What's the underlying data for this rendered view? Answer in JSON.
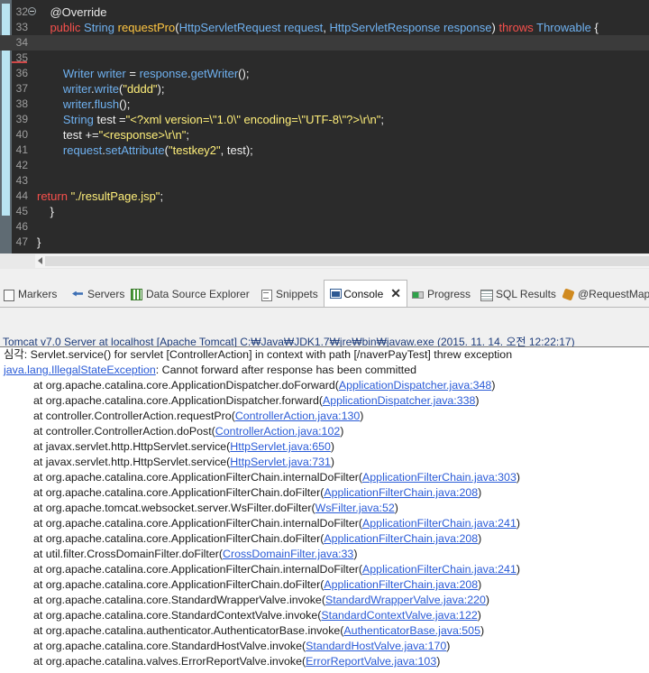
{
  "editor": {
    "lines": [
      {
        "n": "32",
        "tokens": [
          {
            "c": "ann",
            "t": "    @Override"
          }
        ],
        "fold": true
      },
      {
        "n": "33",
        "tokens": [
          {
            "c": "kw",
            "t": "    public"
          },
          {
            "c": "pl",
            "t": " "
          },
          {
            "c": "ty",
            "t": "String"
          },
          {
            "c": "pl",
            "t": " "
          },
          {
            "c": "fn",
            "t": "requestPro"
          },
          {
            "c": "pl",
            "t": "("
          },
          {
            "c": "ty",
            "t": "HttpServletRequest"
          },
          {
            "c": "pl",
            "t": " "
          },
          {
            "c": "ty",
            "t": "request"
          },
          {
            "c": "pl",
            "t": ", "
          },
          {
            "c": "ty",
            "t": "HttpServletResponse"
          },
          {
            "c": "pl",
            "t": " "
          },
          {
            "c": "ty",
            "t": "response"
          },
          {
            "c": "pl",
            "t": ") "
          },
          {
            "c": "kw",
            "t": "throws"
          },
          {
            "c": "pl",
            "t": " "
          },
          {
            "c": "ty",
            "t": "Throwable"
          },
          {
            "c": "pl",
            "t": " {"
          }
        ]
      },
      {
        "n": "34",
        "tokens": [],
        "current": true
      },
      {
        "n": "35",
        "tokens": []
      },
      {
        "n": "36",
        "tokens": [
          {
            "c": "ty",
            "t": "        Writer"
          },
          {
            "c": "pl",
            "t": " "
          },
          {
            "c": "ty",
            "t": "writer"
          },
          {
            "c": "pl",
            "t": " = "
          },
          {
            "c": "ty",
            "t": "response"
          },
          {
            "c": "pl",
            "t": "."
          },
          {
            "c": "ty",
            "t": "getWriter"
          },
          {
            "c": "pl",
            "t": "();"
          }
        ]
      },
      {
        "n": "37",
        "tokens": [
          {
            "c": "ty",
            "t": "        writer"
          },
          {
            "c": "pl",
            "t": "."
          },
          {
            "c": "ty",
            "t": "write"
          },
          {
            "c": "pl",
            "t": "("
          },
          {
            "c": "st",
            "t": "\"dddd\""
          },
          {
            "c": "pl",
            "t": ");"
          }
        ]
      },
      {
        "n": "38",
        "tokens": [
          {
            "c": "ty",
            "t": "        writer"
          },
          {
            "c": "pl",
            "t": "."
          },
          {
            "c": "ty",
            "t": "flush"
          },
          {
            "c": "pl",
            "t": "();"
          }
        ]
      },
      {
        "n": "39",
        "tokens": [
          {
            "c": "ty",
            "t": "        String"
          },
          {
            "c": "pl",
            "t": " test ="
          },
          {
            "c": "st",
            "t": "\"<?xml version=\\\"1.0\\\" encoding=\\\"UTF-8\\\"?>\\r\\n\""
          },
          {
            "c": "pl",
            "t": ";"
          }
        ]
      },
      {
        "n": "40",
        "tokens": [
          {
            "c": "pl",
            "t": "        test +="
          },
          {
            "c": "st",
            "t": "\"<response>\\r\\n\""
          },
          {
            "c": "pl",
            "t": ";"
          }
        ]
      },
      {
        "n": "41",
        "tokens": [
          {
            "c": "ty",
            "t": "        request"
          },
          {
            "c": "pl",
            "t": "."
          },
          {
            "c": "ty",
            "t": "setAttribute"
          },
          {
            "c": "pl",
            "t": "("
          },
          {
            "c": "st",
            "t": "\"testkey2\""
          },
          {
            "c": "pl",
            "t": ", test);"
          }
        ]
      },
      {
        "n": "42",
        "tokens": []
      },
      {
        "n": "43",
        "tokens": []
      },
      {
        "n": "44",
        "tokens": [
          {
            "c": "kw",
            "t": "return"
          },
          {
            "c": "pl",
            "t": " "
          },
          {
            "c": "st",
            "t": "\"./resultPage.jsp\""
          },
          {
            "c": "pl",
            "t": ";"
          }
        ]
      },
      {
        "n": "45",
        "tokens": [
          {
            "c": "pl",
            "t": "    }"
          }
        ]
      },
      {
        "n": "46",
        "tokens": []
      },
      {
        "n": "47",
        "tokens": [
          {
            "c": "pl",
            "t": "}"
          }
        ]
      }
    ]
  },
  "views": {
    "tabs": [
      {
        "label": "Markers",
        "icon": "markers-icon",
        "cls": "ico-markers"
      },
      {
        "label": "Servers",
        "icon": "servers-icon",
        "cls": "ico-servers"
      },
      {
        "label": "Data Source Explorer",
        "icon": "data-source-explorer-icon",
        "cls": "ico-ds"
      },
      {
        "label": "Snippets",
        "icon": "snippets-icon",
        "cls": "ico-snip"
      },
      {
        "label": "Console",
        "icon": "console-icon",
        "cls": "ico-console",
        "active": true,
        "close": "✕"
      },
      {
        "label": "Progress",
        "icon": "progress-icon",
        "cls": "ico-progress"
      },
      {
        "label": "SQL Results",
        "icon": "sql-results-icon",
        "cls": "ico-sql"
      },
      {
        "label": "@RequestMap",
        "icon": "request-mapping-icon",
        "cls": "ico-rm"
      }
    ],
    "console_title": "Tomcat v7.0 Server at localhost [Apache Tomcat] C:₩Java₩JDK1.7₩jre₩bin₩javaw.exe (2015. 11. 14. 오전 12:22:17)"
  },
  "console": {
    "lines": [
      {
        "text": "심각: Servlet.service() for servlet [ControllerAction] in context with path [/naverPayTest] threw exception",
        "indent": false
      },
      {
        "link": "java.lang.IllegalStateException",
        "text": ": Cannot forward after response has been committed",
        "indent": false,
        "leadLink": true
      },
      {
        "text": "at org.apache.catalina.core.ApplicationDispatcher.doForward(",
        "link": "ApplicationDispatcher.java:348",
        "tail": ")",
        "indent": true
      },
      {
        "text": "at org.apache.catalina.core.ApplicationDispatcher.forward(",
        "link": "ApplicationDispatcher.java:338",
        "tail": ")",
        "indent": true
      },
      {
        "text": "at controller.ControllerAction.requestPro(",
        "link": "ControllerAction.java:130",
        "tail": ")",
        "indent": true
      },
      {
        "text": "at controller.ControllerAction.doPost(",
        "link": "ControllerAction.java:102",
        "tail": ")",
        "indent": true
      },
      {
        "text": "at javax.servlet.http.HttpServlet.service(",
        "link": "HttpServlet.java:650",
        "tail": ")",
        "indent": true
      },
      {
        "text": "at javax.servlet.http.HttpServlet.service(",
        "link": "HttpServlet.java:731",
        "tail": ")",
        "indent": true
      },
      {
        "text": "at org.apache.catalina.core.ApplicationFilterChain.internalDoFilter(",
        "link": "ApplicationFilterChain.java:303",
        "tail": ")",
        "indent": true
      },
      {
        "text": "at org.apache.catalina.core.ApplicationFilterChain.doFilter(",
        "link": "ApplicationFilterChain.java:208",
        "tail": ")",
        "indent": true
      },
      {
        "text": "at org.apache.tomcat.websocket.server.WsFilter.doFilter(",
        "link": "WsFilter.java:52",
        "tail": ")",
        "indent": true
      },
      {
        "text": "at org.apache.catalina.core.ApplicationFilterChain.internalDoFilter(",
        "link": "ApplicationFilterChain.java:241",
        "tail": ")",
        "indent": true
      },
      {
        "text": "at org.apache.catalina.core.ApplicationFilterChain.doFilter(",
        "link": "ApplicationFilterChain.java:208",
        "tail": ")",
        "indent": true
      },
      {
        "text": "at util.filter.CrossDomainFilter.doFilter(",
        "link": "CrossDomainFilter.java:33",
        "tail": ")",
        "indent": true
      },
      {
        "text": "at org.apache.catalina.core.ApplicationFilterChain.internalDoFilter(",
        "link": "ApplicationFilterChain.java:241",
        "tail": ")",
        "indent": true
      },
      {
        "text": "at org.apache.catalina.core.ApplicationFilterChain.doFilter(",
        "link": "ApplicationFilterChain.java:208",
        "tail": ")",
        "indent": true
      },
      {
        "text": "at org.apache.catalina.core.StandardWrapperValve.invoke(",
        "link": "StandardWrapperValve.java:220",
        "tail": ")",
        "indent": true
      },
      {
        "text": "at org.apache.catalina.core.StandardContextValve.invoke(",
        "link": "StandardContextValve.java:122",
        "tail": ")",
        "indent": true
      },
      {
        "text": "at org.apache.catalina.authenticator.AuthenticatorBase.invoke(",
        "link": "AuthenticatorBase.java:505",
        "tail": ")",
        "indent": true
      },
      {
        "text": "at org.apache.catalina.core.StandardHostValve.invoke(",
        "link": "StandardHostValve.java:170",
        "tail": ")",
        "indent": true
      },
      {
        "text": "at org.apache.catalina.valves.ErrorReportValve.invoke(",
        "link": "ErrorReportValve.java:103",
        "tail": ")",
        "indent": true
      }
    ]
  },
  "colors": {
    "editor_bg": "#2b2b2b",
    "keyword": "#f7504c",
    "type": "#6fb1f0",
    "method": "#ffc642",
    "string": "#ffef7a",
    "link": "#2a5bd7",
    "console_title": "#1d3b7a"
  }
}
